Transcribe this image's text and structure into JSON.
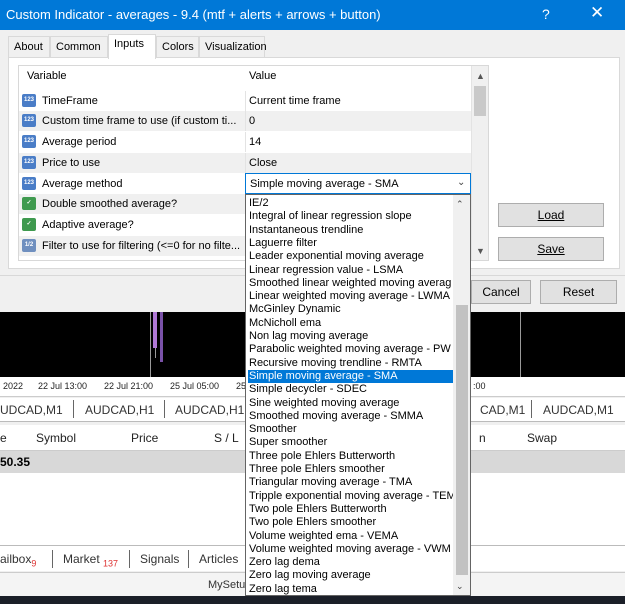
{
  "dialog": {
    "title": "Custom Indicator - averages - 9.4 (mtf + alerts + arrows + button)",
    "help": "?",
    "close": "✕",
    "tabs": [
      "About",
      "Common",
      "Inputs",
      "Colors",
      "Visualization"
    ],
    "active_tab": "Inputs"
  },
  "grid": {
    "headers": {
      "variable": "Variable",
      "value": "Value"
    },
    "rows": [
      {
        "icon": "123",
        "variable": "TimeFrame",
        "value": "Current time frame"
      },
      {
        "icon": "123",
        "variable": "Custom time frame to use (if custom ti...",
        "value": "0"
      },
      {
        "icon": "123",
        "variable": "Average period",
        "value": "14"
      },
      {
        "icon": "123",
        "variable": "Price to use",
        "value": "Close"
      },
      {
        "icon": "123",
        "variable": "Average method",
        "value": "Simple moving average - SMA"
      },
      {
        "icon": "bool",
        "variable": "Double smoothed average?",
        "value": ""
      },
      {
        "icon": "bool",
        "variable": "Adaptive average?",
        "value": ""
      },
      {
        "icon": "1/2",
        "variable": "Filter to use for filtering (<=0 for no filte...",
        "value": ""
      }
    ]
  },
  "buttons": {
    "load": "Load",
    "save": "Save",
    "cancel": "Cancel",
    "reset": "Reset"
  },
  "dropdown": {
    "selected": "Simple moving average - SMA",
    "options": [
      "IE/2",
      "Integral of linear regression slope",
      "Instantaneous trendline",
      "Laguerre filter",
      "Leader exponential moving average",
      "Linear regression value - LSMA",
      "Smoothed linear weighted moving averag",
      "Linear weighted moving average - LWMA",
      "McGinley Dynamic",
      "McNicholl ema",
      "Non lag moving average",
      "Parabolic weighted moving average - PW",
      "Recursive moving trendline - RMTA",
      "Simple moving average - SMA",
      "Simple decycler - SDEC",
      "Sine weighted moving average",
      "Smoothed moving average - SMMA",
      "Smoother",
      "Super smoother",
      "Three pole Ehlers Butterworth",
      "Three pole Ehlers smoother",
      "Triangular moving average - TMA",
      "Tripple exponential moving average - TEM",
      "Two pole Ehlers Butterworth",
      "Two pole Ehlers smoother",
      "Volume weighted ema - VEMA",
      "Volume weighted moving average - VWM",
      "Zero lag dema",
      "Zero lag moving average",
      "Zero lag tema"
    ]
  },
  "terminal": {
    "time_ticks": [
      "2022",
      "22 Jul 13:00",
      "22 Jul 21:00",
      "25 Jul 05:00",
      "25",
      ":00"
    ],
    "symbol_tabs": [
      "UDCAD,M1",
      "AUDCAD,H1",
      "AUDCAD,H1",
      "CAD,M1",
      "AUDCAD,M1"
    ],
    "columns": [
      "e",
      "Symbol",
      "Price",
      "S / L",
      "n",
      "Swap"
    ],
    "balance": "50.35",
    "bottom_tabs": [
      {
        "label": "ailbox",
        "badge": "9"
      },
      {
        "label": "Market",
        "badge": "137"
      },
      {
        "label": "Signals",
        "badge": ""
      },
      {
        "label": "Articles",
        "badge": ""
      }
    ],
    "status_text": "MySetu"
  }
}
